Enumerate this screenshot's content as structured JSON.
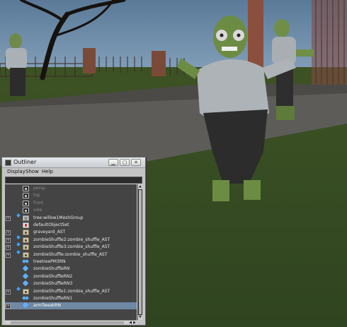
{
  "outliner": {
    "title": "Outliner",
    "menu": [
      "Display",
      "Show",
      "Help"
    ],
    "filter_value": "",
    "items": [
      {
        "label": "persp",
        "icon": "camera-icon",
        "kind": "camera",
        "hidden": true,
        "expandable": false,
        "badge": false,
        "selected": false
      },
      {
        "label": "top",
        "icon": "camera-icon",
        "kind": "camera",
        "hidden": true,
        "expandable": false,
        "badge": false,
        "selected": false
      },
      {
        "label": "front",
        "icon": "camera-icon",
        "kind": "camera",
        "hidden": true,
        "expandable": false,
        "badge": false,
        "selected": false
      },
      {
        "label": "side",
        "icon": "camera-icon",
        "kind": "camera",
        "hidden": true,
        "expandable": false,
        "badge": false,
        "selected": false
      },
      {
        "label": "tree:willow1MeshGroup",
        "icon": "group-icon",
        "kind": "group",
        "hidden": false,
        "expandable": true,
        "badge": true,
        "selected": false
      },
      {
        "label": "defaultObjectSet",
        "icon": "set-icon",
        "kind": "set",
        "hidden": false,
        "expandable": false,
        "badge": false,
        "selected": false
      },
      {
        "label": "graveyard_AST",
        "icon": "asset-icon",
        "kind": "asset",
        "hidden": false,
        "expandable": true,
        "badge": false,
        "selected": false
      },
      {
        "label": "zombieShuffle2:zombie_shuffle_AST",
        "icon": "asset-icon",
        "kind": "asset",
        "hidden": false,
        "expandable": true,
        "badge": true,
        "selected": false
      },
      {
        "label": "zombieShuffle3:zombie_shuffle_AST",
        "icon": "asset-icon",
        "kind": "asset",
        "hidden": false,
        "expandable": true,
        "badge": true,
        "selected": false
      },
      {
        "label": "zombieShuffle:zombie_shuffle_AST",
        "icon": "asset-icon",
        "kind": "asset",
        "hidden": false,
        "expandable": true,
        "badge": true,
        "selected": false
      },
      {
        "label": "treetreePM3RN",
        "icon": "reference-pair-icon",
        "kind": "dup",
        "hidden": false,
        "expandable": false,
        "badge": false,
        "selected": false
      },
      {
        "label": "zombieShuffleRN",
        "icon": "reference-icon",
        "kind": "ref",
        "hidden": false,
        "expandable": false,
        "badge": false,
        "selected": false
      },
      {
        "label": "zombieShuffleRN2",
        "icon": "reference-icon",
        "kind": "ref",
        "hidden": false,
        "expandable": false,
        "badge": false,
        "selected": false
      },
      {
        "label": "zombieShuffleRN3",
        "icon": "reference-icon",
        "kind": "ref",
        "hidden": false,
        "expandable": false,
        "badge": false,
        "selected": false
      },
      {
        "label": "zombieShuffle1:zombie_shuffle_AST",
        "icon": "asset-icon",
        "kind": "asset",
        "hidden": false,
        "expandable": true,
        "badge": true,
        "selected": false
      },
      {
        "label": "zombieShuffleRN1",
        "icon": "reference-pair-icon",
        "kind": "dup",
        "hidden": false,
        "expandable": false,
        "badge": false,
        "selected": false
      },
      {
        "label": "armTweakRN",
        "icon": "reference-icon",
        "kind": "ref",
        "hidden": false,
        "expandable": true,
        "badge": false,
        "selected": true
      }
    ]
  }
}
